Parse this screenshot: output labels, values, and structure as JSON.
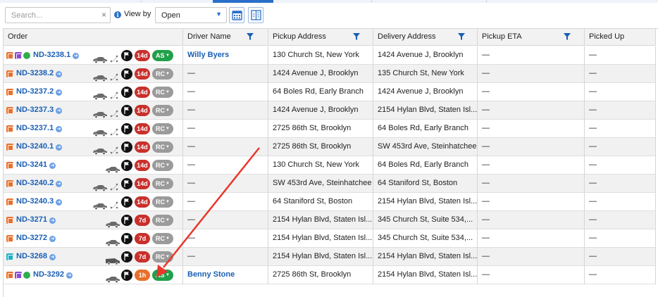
{
  "toolbar": {
    "search_placeholder": "Search...",
    "clear_glyph": "×",
    "info_glyph": "i",
    "viewby_label": "View by",
    "viewby_value": "Open",
    "caret_glyph": "▼",
    "calendar_button_icon": "calendar-icon",
    "layout_button_icon": "column-layout-icon"
  },
  "accent_color": "#1a5fb4",
  "headers": {
    "order": "Order",
    "driver": "Driver Name",
    "pickup": "Pickup Address",
    "delivery": "Delivery Address",
    "pickup_eta": "Pickup ETA",
    "picked_up": "Picked Up"
  },
  "rows": [
    {
      "order": "ND-3238.1",
      "driver": "Willy Byers",
      "pickup": "130 Church St, New York",
      "delivery": "1424 Avenue J, Brooklyn",
      "pickup_eta": "—",
      "picked_up": "—",
      "age": "14d",
      "status": "AS"
    },
    {
      "order": "ND-3238.2",
      "driver": "—",
      "pickup": "1424 Avenue J, Brooklyn",
      "delivery": "135 Church St, New York",
      "pickup_eta": "—",
      "picked_up": "—",
      "age": "14d",
      "status": "RC"
    },
    {
      "order": "ND-3237.2",
      "driver": "—",
      "pickup": "64 Boles Rd, Early Branch",
      "delivery": "1424 Avenue J, Brooklyn",
      "pickup_eta": "—",
      "picked_up": "—",
      "age": "14d",
      "status": "RC"
    },
    {
      "order": "ND-3237.3",
      "driver": "—",
      "pickup": "1424 Avenue J, Brooklyn",
      "delivery": "2154 Hylan Blvd, Staten Isl...",
      "pickup_eta": "—",
      "picked_up": "—",
      "age": "14d",
      "status": "RC"
    },
    {
      "order": "ND-3237.1",
      "driver": "—",
      "pickup": "2725 86th St, Brooklyn",
      "delivery": "64 Boles Rd, Early Branch",
      "pickup_eta": "—",
      "picked_up": "—",
      "age": "14d",
      "status": "RC"
    },
    {
      "order": "ND-3240.1",
      "driver": "—",
      "pickup": "2725 86th St, Brooklyn",
      "delivery": "SW 453rd Ave, Steinhatchee",
      "pickup_eta": "—",
      "picked_up": "—",
      "age": "14d",
      "status": "RC"
    },
    {
      "order": "ND-3241",
      "driver": "—",
      "pickup": "130 Church St, New York",
      "delivery": "64 Boles Rd, Early Branch",
      "pickup_eta": "—",
      "picked_up": "—",
      "age": "14d",
      "status": "RC"
    },
    {
      "order": "ND-3240.2",
      "driver": "—",
      "pickup": "SW 453rd Ave, Steinhatchee",
      "delivery": "64 Staniford St, Boston",
      "pickup_eta": "—",
      "picked_up": "—",
      "age": "14d",
      "status": "RC"
    },
    {
      "order": "ND-3240.3",
      "driver": "—",
      "pickup": "64 Staniford St, Boston",
      "delivery": "2154 Hylan Blvd, Staten Isl...",
      "pickup_eta": "—",
      "picked_up": "—",
      "age": "14d",
      "status": "RC"
    },
    {
      "order": "ND-3271",
      "driver": "—",
      "pickup": "2154 Hylan Blvd, Staten Isl...",
      "delivery": "345 Church St, Suite 534,...",
      "pickup_eta": "—",
      "picked_up": "—",
      "age": "7d",
      "status": "RC"
    },
    {
      "order": "ND-3272",
      "driver": "—",
      "pickup": "2154 Hylan Blvd, Staten Isl...",
      "delivery": "345 Church St, Suite 534,...",
      "pickup_eta": "—",
      "picked_up": "—",
      "age": "7d",
      "status": "RC"
    },
    {
      "order": "ND-3268",
      "driver": "—",
      "pickup": "2154 Hylan Blvd, Staten Isl...",
      "delivery": "2154 Hylan Blvd, Staten Isl...",
      "pickup_eta": "—",
      "picked_up": "—",
      "age": "7d",
      "status": "RC"
    },
    {
      "order": "ND-3292",
      "driver": "Benny Stone",
      "pickup": "2725 86th St, Brooklyn",
      "delivery": "2154 Hylan Blvd, Staten Isl...",
      "pickup_eta": "—",
      "picked_up": "—",
      "age": "1h",
      "status": "AS"
    }
  ],
  "arrow_color": "#e8372b"
}
